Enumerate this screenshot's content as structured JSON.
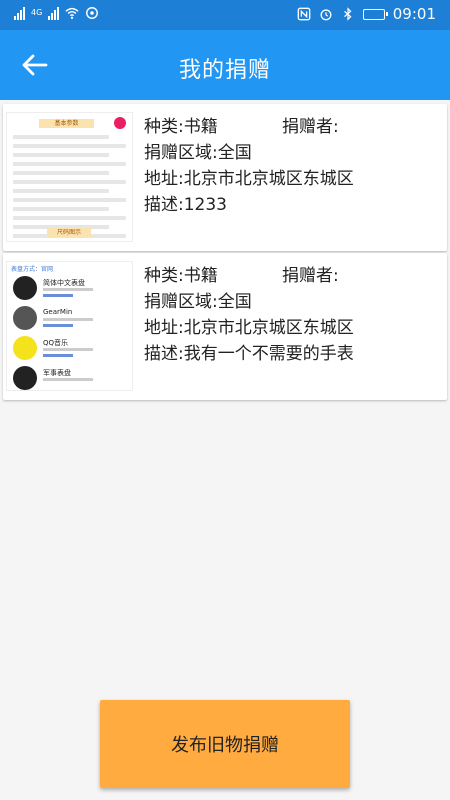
{
  "status_bar": {
    "network": "4G",
    "time": "09:01"
  },
  "app_bar": {
    "title": "我的捐赠",
    "back_icon": "arrow-left-icon"
  },
  "donations": [
    {
      "category_label": "种类:",
      "category": "书籍",
      "donor_label": "捐赠者:",
      "donor": "",
      "region_label": "捐赠区域:",
      "region": "全国",
      "address_label": "地址:",
      "address": "北京市北京城区东城区",
      "desc_label": "描述:",
      "desc": "1233",
      "thumb": {
        "title": "基本参数",
        "footer": "尺码图示"
      }
    },
    {
      "category_label": "种类:",
      "category": "书籍",
      "donor_label": "捐赠者:",
      "donor": "",
      "region_label": "捐赠区域:",
      "region": "全国",
      "address_label": "地址:",
      "address": "北京市北京城区东城区",
      "desc_label": "描述:",
      "desc": "我有一个不需要的手表",
      "thumb": {
        "header": "表盘方式：官网",
        "items": [
          "简体中文表盘",
          "GearMin",
          "QQ音乐",
          "军事表盘"
        ]
      }
    }
  ],
  "publish_button": "发布旧物捐赠",
  "colors": {
    "status_bar": "#1e7fd6",
    "app_bar": "#2196f3",
    "button": "#ffab40"
  }
}
